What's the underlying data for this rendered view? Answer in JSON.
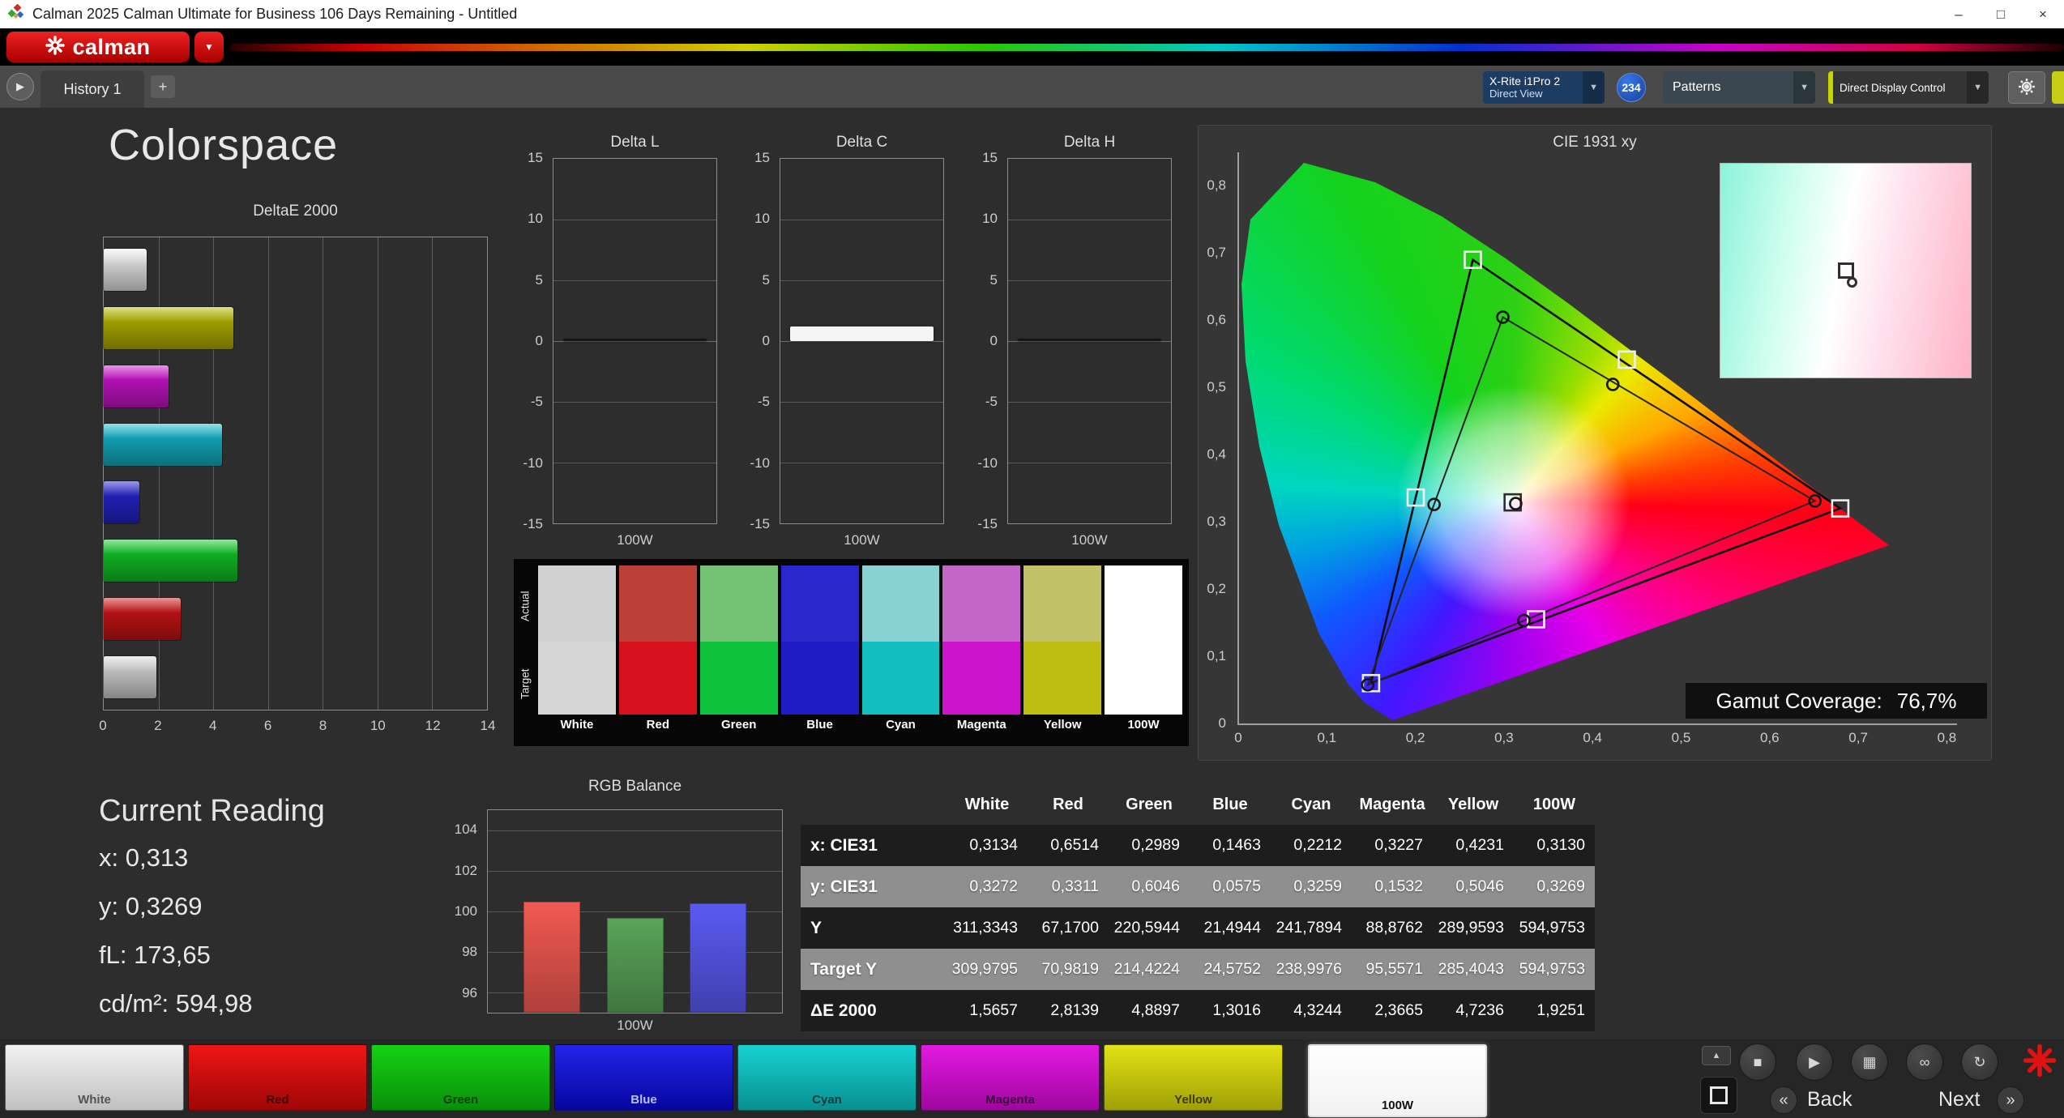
{
  "window": {
    "title": "Calman 2025 Calman Ultimate for Business 106 Days Remaining  - Untitled",
    "minimize": "–",
    "maximize": "□",
    "close": "×"
  },
  "brand": {
    "name": "calman"
  },
  "toolbar": {
    "tab": "History 1",
    "add_tab": "+",
    "meter_device": {
      "line1": "X-Rite i1Pro 2",
      "line2": "Direct View"
    },
    "badge_count": "234",
    "patterns_label": "Patterns",
    "display_control_label": "Direct Display Control",
    "dropdown_arrow": "▼"
  },
  "main": {
    "page_title": "Colorspace",
    "current_reading": {
      "title": "Current Reading",
      "lines": [
        "x: 0,313",
        "y: 0,3269",
        "fL: 173,65",
        "cd/m²: 594,98"
      ]
    },
    "gamut_coverage_label": "Gamut Coverage:",
    "gamut_coverage_value": "76,7%"
  },
  "chart_data": [
    {
      "id": "deltaE2000",
      "type": "bar",
      "orientation": "horizontal",
      "title": "DeltaE 2000",
      "categories": [
        "White",
        "Yellow",
        "Magenta",
        "Cyan",
        "Blue",
        "Green",
        "Red",
        "100W"
      ],
      "values": [
        1.5657,
        4.7236,
        2.3665,
        4.3244,
        1.3016,
        4.8897,
        2.8139,
        1.9251
      ],
      "bar_colors": [
        "#ececec",
        "#b6b600",
        "#cc14cc",
        "#14b6c8",
        "#2424cc",
        "#10c828",
        "#cc1616",
        "#d8d8d8"
      ],
      "xlim": [
        0,
        14
      ],
      "xticks": [
        0,
        2,
        4,
        6,
        8,
        10,
        12,
        14
      ]
    },
    {
      "id": "deltaL",
      "type": "bar",
      "title": "Delta L",
      "categories": [
        "100W"
      ],
      "values": [
        0.0
      ],
      "bar_color": "#161616",
      "ylim": [
        -15,
        15
      ],
      "yticks": [
        15,
        10,
        5,
        0,
        -5,
        -10,
        -15
      ],
      "xlabel": "100W"
    },
    {
      "id": "deltaC",
      "type": "bar",
      "title": "Delta C",
      "categories": [
        "100W"
      ],
      "values": [
        1.2
      ],
      "bar_color": "#f5f5f5",
      "ylim": [
        -15,
        15
      ],
      "yticks": [
        15,
        10,
        5,
        0,
        -5,
        -10,
        -15
      ],
      "xlabel": "100W"
    },
    {
      "id": "deltaH",
      "type": "bar",
      "title": "Delta H",
      "categories": [
        "100W"
      ],
      "values": [
        0.0
      ],
      "bar_color": "#161616",
      "ylim": [
        -15,
        15
      ],
      "yticks": [
        15,
        10,
        5,
        0,
        -5,
        -10,
        -15
      ],
      "xlabel": "100W"
    },
    {
      "id": "cie",
      "type": "scatter",
      "title": "CIE 1931 xy",
      "xlim": [
        0,
        0.8
      ],
      "ylim": [
        0,
        0.8
      ],
      "xticks": [
        "0",
        "0,1",
        "0,2",
        "0,3",
        "0,4",
        "0,5",
        "0,6",
        "0,7",
        "0,8"
      ],
      "yticks": [
        "0",
        "0,1",
        "0,2",
        "0,3",
        "0,4",
        "0,5",
        "0,6",
        "0,7",
        "0,8"
      ],
      "target_gamut": {
        "red": [
          0.68,
          0.32
        ],
        "green": [
          0.265,
          0.69
        ],
        "blue": [
          0.15,
          0.06
        ]
      },
      "measured_gamut": {
        "red": [
          0.6514,
          0.3311
        ],
        "green": [
          0.2989,
          0.6046
        ],
        "blue": [
          0.1463,
          0.0575
        ]
      },
      "target_points": [
        [
          0.31,
          0.329
        ],
        [
          0.68,
          0.32
        ],
        [
          0.265,
          0.69
        ],
        [
          0.15,
          0.06
        ],
        [
          0.2005,
          0.3363
        ],
        [
          0.3364,
          0.1551
        ],
        [
          0.4389,
          0.5415
        ]
      ],
      "measured_points": [
        [
          0.3134,
          0.3272
        ],
        [
          0.6514,
          0.3311
        ],
        [
          0.2989,
          0.6046
        ],
        [
          0.1463,
          0.0575
        ],
        [
          0.2212,
          0.3259
        ],
        [
          0.3227,
          0.1532
        ],
        [
          0.4231,
          0.5046
        ]
      ],
      "gamut_coverage": "76,7%"
    },
    {
      "id": "rgbBalance",
      "type": "bar",
      "title": "RGB Balance",
      "categories": [
        "Red",
        "Green",
        "Blue"
      ],
      "values": [
        100.5,
        99.7,
        100.4
      ],
      "bar_colors": [
        "#f25a52",
        "#5aa45a",
        "#5a5af2"
      ],
      "ylim": [
        95,
        105
      ],
      "yticks": [
        104,
        102,
        100,
        98,
        96
      ],
      "xlabel": "100W"
    },
    {
      "id": "results",
      "type": "table",
      "columns": [
        "White",
        "Red",
        "Green",
        "Blue",
        "Cyan",
        "Magenta",
        "Yellow",
        "100W"
      ],
      "rows": [
        {
          "label": "x: CIE31",
          "values": [
            "0,3134",
            "0,6514",
            "0,2989",
            "0,1463",
            "0,2212",
            "0,3227",
            "0,4231",
            "0,3130"
          ]
        },
        {
          "label": "y: CIE31",
          "values": [
            "0,3272",
            "0,3311",
            "0,6046",
            "0,0575",
            "0,3259",
            "0,1532",
            "0,5046",
            "0,3269"
          ]
        },
        {
          "label": "Y",
          "values": [
            "311,3343",
            "67,1700",
            "220,5944",
            "21,4944",
            "241,7894",
            "88,8762",
            "289,9593",
            "594,9753"
          ]
        },
        {
          "label": "Target Y",
          "values": [
            "309,9795",
            "70,9819",
            "214,4224",
            "24,5752",
            "238,9976",
            "95,5571",
            "285,4043",
            "594,9753"
          ]
        },
        {
          "label": "ΔE 2000",
          "values": [
            "1,5657",
            "2,8139",
            "4,8897",
            "1,3016",
            "4,3244",
            "2,3665",
            "4,7236",
            "1,9251"
          ]
        }
      ]
    }
  ],
  "swatches": {
    "row_labels": [
      "Actual",
      "Target"
    ],
    "columns": [
      "White",
      "Red",
      "Green",
      "Blue",
      "Cyan",
      "Magenta",
      "Yellow",
      "100W"
    ],
    "actual_colors": [
      "#d2d2d2",
      "#bc4038",
      "#74c274",
      "#2a28cc",
      "#8ad2d2",
      "#c465ca",
      "#c2c268",
      "#ffffff"
    ],
    "target_colors": [
      "#d6d6d6",
      "#d6121e",
      "#0ec23e",
      "#1e1cc4",
      "#12bebe",
      "#cc14cc",
      "#bebe12",
      "#ffffff"
    ]
  },
  "pattern_buttons": [
    {
      "label": "White",
      "color_top": "#f2f2f2",
      "color_bottom": "#c0c0c0",
      "text": "#555555",
      "selected": false
    },
    {
      "label": "Red",
      "color_top": "#ee1616",
      "color_bottom": "#a00606",
      "text": "#3a0404",
      "selected": false
    },
    {
      "label": "Green",
      "color_top": "#16d216",
      "color_bottom": "#089008",
      "text": "#043a04",
      "selected": false
    },
    {
      "label": "Blue",
      "color_top": "#2424ea",
      "color_bottom": "#0606a0",
      "text": "#b8c0f0",
      "selected": false
    },
    {
      "label": "Cyan",
      "color_top": "#16d2d2",
      "color_bottom": "#089090",
      "text": "#043a3a",
      "selected": false
    },
    {
      "label": "Magenta",
      "color_top": "#e21ae2",
      "color_bottom": "#a006a0",
      "text": "#3a043a",
      "selected": false
    },
    {
      "label": "Yellow",
      "color_top": "#e2e216",
      "color_bottom": "#a0a006",
      "text": "#3a3a04",
      "selected": false
    },
    {
      "label": "100W",
      "color_top": "#ffffff",
      "color_bottom": "#f2f2f2",
      "text": "#111111",
      "selected": true
    }
  ],
  "transport": {
    "up": "▲",
    "buttons": [
      {
        "name": "stop",
        "glyph": "■"
      },
      {
        "name": "play",
        "glyph": "▶"
      },
      {
        "name": "save",
        "glyph": "▦"
      },
      {
        "name": "link",
        "glyph": "∞"
      },
      {
        "name": "refresh",
        "glyph": "↻"
      }
    ],
    "back_label": "Back",
    "next_label": "Next",
    "back_icon": "«",
    "next_icon": "»"
  }
}
